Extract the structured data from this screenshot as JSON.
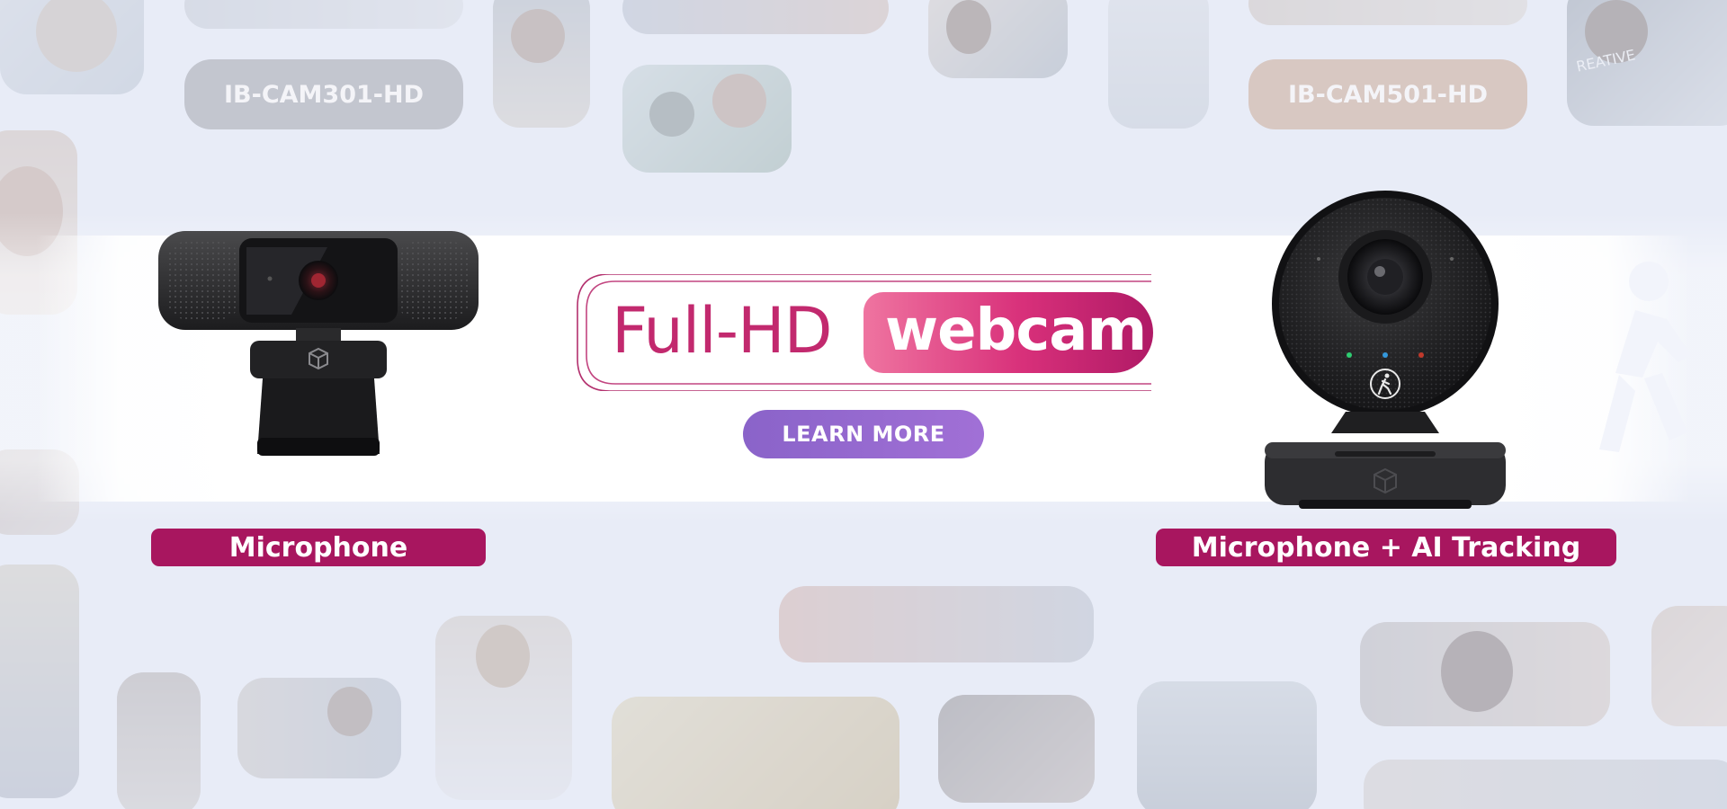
{
  "background": {
    "model_tags": [
      "IB-CAM301-HD",
      "IB-CAM501-HD"
    ],
    "watermark_text": "REATIVE"
  },
  "headline": {
    "part1": "Full-HD",
    "part2": "webcam"
  },
  "cta": {
    "label": "LEARN MORE"
  },
  "products": [
    {
      "feature_label": "Microphone"
    },
    {
      "feature_label": "Microphone + AI Tracking"
    }
  ],
  "colors": {
    "brand_magenta": "#a8165f",
    "headline_pink": "#c2296e",
    "cta_purple": "#9468cf",
    "background": "#e8ecf7"
  },
  "icons": [
    "cube-logo-icon",
    "walking-person-icon"
  ]
}
